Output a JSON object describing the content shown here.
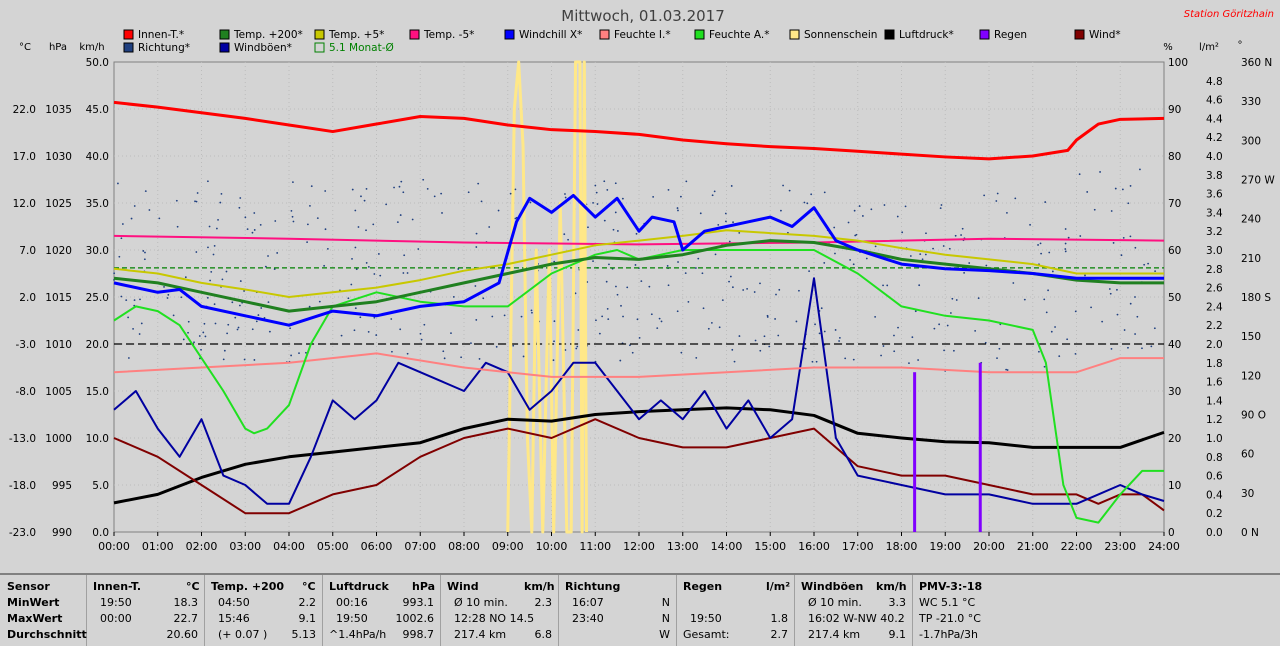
{
  "title": "Mittwoch, 01.03.2017",
  "station": "Station Göritzhain",
  "colors": {
    "bg": "#d4d4d4",
    "plot": "#d4d4d4",
    "innen": "#ff0000",
    "t200": "#208020",
    "t5": "#c8c800",
    "tm5": "#ff1080",
    "windchill": "#0000ff",
    "feuchte_i": "#ff8080",
    "feuchte_a": "#20e020",
    "sonne": "#ffe888",
    "luftdruck": "#000000",
    "regen": "#8000ff",
    "wind": "#800000",
    "richtung": "#204080",
    "boeen": "#0000a0",
    "monat": "#008000"
  },
  "legend": [
    {
      "label": "Innen-T.*",
      "color": "#ff0000"
    },
    {
      "label": "Temp. +200*",
      "color": "#208020"
    },
    {
      "label": "Temp. +5*",
      "color": "#c8c800"
    },
    {
      "label": "Temp. -5*",
      "color": "#ff1080"
    },
    {
      "label": "Windchill X*",
      "color": "#0000ff"
    },
    {
      "label": "Feuchte I.*",
      "color": "#ff8080"
    },
    {
      "label": "Feuchte A.*",
      "color": "#20e020"
    },
    {
      "label": "Sonnenschein",
      "color": "#ffe888"
    },
    {
      "label": "Luftdruck*",
      "color": "#000000"
    },
    {
      "label": "Regen",
      "color": "#8000ff"
    },
    {
      "label": "Wind*",
      "color": "#800000"
    },
    {
      "label": "Richtung*",
      "color": "#204080"
    },
    {
      "label": "Windböen*",
      "color": "#0000a0"
    },
    {
      "label": "5.1 Monat-Ø",
      "color": "#008000",
      "hollow": true
    }
  ],
  "axis_units": {
    "temp": "°C",
    "press": "hPa",
    "wind": "km/h",
    "hum": "%",
    "rain": "l/m²",
    "dir": "°"
  },
  "chart_data": {
    "type": "line",
    "x_unit": "hours",
    "xlim": [
      0,
      24
    ],
    "x_ticks": [
      "00:00",
      "01:00",
      "02:00",
      "03:00",
      "04:00",
      "05:00",
      "06:00",
      "07:00",
      "08:00",
      "09:00",
      "10:00",
      "11:00",
      "12:00",
      "13:00",
      "14:00",
      "15:00",
      "16:00",
      "17:00",
      "18:00",
      "19:00",
      "20:00",
      "21:00",
      "22:00",
      "23:00",
      "24:00"
    ],
    "axes": {
      "temp": {
        "ticks": [
          "22.0",
          "17.0",
          "12.0",
          "7.0",
          "2.0",
          "-3.0",
          "-8.0",
          "-13.0",
          "-18.0",
          "-23.0"
        ],
        "ylim": [
          -23,
          27
        ]
      },
      "press": {
        "ticks": [
          "1035",
          "1030",
          "1025",
          "1020",
          "1015",
          "1010",
          "1005",
          "1000",
          "995",
          "990"
        ],
        "ylim": [
          990,
          1040
        ]
      },
      "wind": {
        "ticks": [
          "50.0",
          "45.0",
          "40.0",
          "35.0",
          "30.0",
          "25.0",
          "20.0",
          "15.0",
          "10.0",
          "5.0",
          "0.0"
        ],
        "ylim": [
          0,
          50
        ]
      },
      "hum": {
        "ticks": [
          "100",
          "90",
          "80",
          "70",
          "60",
          "50",
          "40",
          "30",
          "20",
          "10",
          "0"
        ],
        "ylim": [
          0,
          100
        ]
      },
      "rain": {
        "ticks": [
          "4.8",
          "4.6",
          "4.4",
          "4.2",
          "4.0",
          "3.8",
          "3.6",
          "3.4",
          "3.2",
          "3.0",
          "2.8",
          "2.6",
          "2.4",
          "2.2",
          "2.0",
          "1.8",
          "1.6",
          "1.4",
          "1.2",
          "1.0",
          "0.8",
          "0.6",
          "0.4",
          "0.2",
          "0.0"
        ],
        "ylim": [
          0,
          5
        ]
      },
      "dir": {
        "ticks": [
          "360 N",
          "330",
          "300",
          "270 W",
          "240",
          "210",
          "180 S",
          "150",
          "120",
          "90 O",
          "60",
          "30",
          "0 N"
        ],
        "ylim": [
          0,
          360
        ]
      }
    },
    "series": [
      {
        "name": "Innen-T.*",
        "axis": "temp",
        "color": "#ff0000",
        "width": 3,
        "x": [
          0,
          1,
          2,
          3,
          4,
          5,
          6,
          7,
          8,
          9,
          10,
          11,
          12,
          13,
          14,
          15,
          16,
          17,
          18,
          19,
          20,
          21,
          21.8,
          22,
          22.5,
          23,
          24
        ],
        "y": [
          22.7,
          22.2,
          21.6,
          21.0,
          20.3,
          19.6,
          20.4,
          21.2,
          21.0,
          20.3,
          19.8,
          19.6,
          19.3,
          18.7,
          18.3,
          18.0,
          17.8,
          17.5,
          17.2,
          16.9,
          16.7,
          17.0,
          17.6,
          18.7,
          20.4,
          20.9,
          21.0
        ]
      },
      {
        "name": "Temp. +200*",
        "axis": "temp",
        "color": "#208020",
        "width": 3,
        "x": [
          0,
          1,
          2,
          3,
          4,
          5,
          6,
          7,
          8,
          9,
          10,
          11,
          12,
          13,
          14,
          15,
          16,
          17,
          18,
          19,
          20,
          21,
          22,
          23,
          24
        ],
        "y": [
          4.0,
          3.5,
          2.5,
          1.5,
          0.5,
          1.0,
          1.5,
          2.5,
          3.5,
          4.5,
          5.5,
          6.2,
          6.0,
          6.5,
          7.5,
          8.0,
          7.8,
          7.0,
          6.0,
          5.5,
          5.0,
          4.5,
          3.8,
          3.5,
          3.5
        ]
      },
      {
        "name": "Temp. +5*",
        "axis": "temp",
        "color": "#c8c800",
        "width": 2,
        "x": [
          0,
          1,
          2,
          3,
          4,
          5,
          6,
          7,
          8,
          9,
          10,
          11,
          12,
          13,
          14,
          15,
          16,
          17,
          18,
          19,
          20,
          21,
          22,
          23,
          24
        ],
        "y": [
          5.0,
          4.5,
          3.5,
          2.8,
          2.0,
          2.5,
          3.0,
          3.8,
          4.8,
          5.5,
          6.5,
          7.5,
          8.0,
          8.5,
          9.1,
          8.8,
          8.5,
          8.0,
          7.2,
          6.5,
          6.0,
          5.5,
          4.5,
          4.5,
          4.5
        ]
      },
      {
        "name": "Temp. -5*",
        "axis": "temp",
        "color": "#ff1080",
        "width": 2,
        "x": [
          0,
          4,
          8,
          12,
          16,
          20,
          24
        ],
        "y": [
          8.5,
          8.2,
          7.8,
          7.6,
          7.8,
          8.2,
          8.0
        ]
      },
      {
        "name": "Windchill X*",
        "axis": "temp",
        "color": "#0000ff",
        "width": 3,
        "x": [
          0,
          1,
          1.5,
          2,
          3,
          4,
          5,
          6,
          7,
          8,
          8.8,
          9.2,
          9.5,
          10,
          10.5,
          11,
          11.5,
          12,
          12.3,
          12.8,
          13,
          13.5,
          14,
          14.5,
          15,
          15.5,
          16,
          16.5,
          17,
          18,
          19,
          20,
          21,
          22,
          23,
          24
        ],
        "y": [
          3.5,
          2.5,
          2.8,
          1.0,
          0.0,
          -1.0,
          0.5,
          0.0,
          1.0,
          1.5,
          3.5,
          10.0,
          12.5,
          11.0,
          12.8,
          10.5,
          12.5,
          9.0,
          10.5,
          10.0,
          7.0,
          9.0,
          9.5,
          10.0,
          10.5,
          9.5,
          11.5,
          8.0,
          7.0,
          5.5,
          5.0,
          4.8,
          4.5,
          4.0,
          4.0,
          4.0
        ]
      },
      {
        "name": "Feuchte I.*",
        "axis": "hum",
        "color": "#ff8080",
        "width": 2,
        "x": [
          0,
          2,
          4,
          6,
          8,
          10,
          12,
          14,
          16,
          18,
          20,
          22,
          23,
          24
        ],
        "y": [
          34,
          35,
          36,
          38,
          35,
          33,
          33,
          34,
          35,
          35,
          34,
          34,
          37,
          37
        ]
      },
      {
        "name": "Feuchte A.*",
        "axis": "hum",
        "color": "#20e020",
        "width": 2,
        "x": [
          0,
          0.5,
          1,
          1.5,
          2,
          2.5,
          3,
          3.2,
          3.5,
          4,
          4.5,
          5,
          6,
          7,
          8,
          9,
          10,
          11,
          11.5,
          12,
          13,
          14,
          15,
          16,
          17,
          18,
          19,
          20,
          21,
          21.3,
          21.7,
          22,
          22.5,
          23,
          23.5,
          24
        ],
        "y": [
          45,
          48,
          47,
          44,
          37,
          30,
          22,
          21,
          22,
          27,
          40,
          48,
          51,
          49,
          48,
          48,
          55,
          59,
          60,
          58,
          60,
          60,
          60,
          60,
          55,
          48,
          46,
          45,
          43,
          36,
          10,
          3,
          2,
          8,
          13,
          13
        ]
      },
      {
        "name": "Luftdruck*",
        "axis": "press",
        "color": "#000000",
        "width": 3,
        "x": [
          0,
          1,
          2,
          3,
          4,
          5,
          6,
          7,
          8,
          9,
          10,
          11,
          12,
          13,
          14,
          15,
          16,
          17,
          18,
          19,
          20,
          21,
          22,
          23,
          24
        ],
        "y": [
          993.1,
          994.0,
          995.8,
          997.2,
          998.0,
          998.5,
          999.0,
          999.5,
          1001.0,
          1002.0,
          1001.8,
          1002.5,
          1002.8,
          1003.0,
          1003.2,
          1003.0,
          1002.4,
          1000.5,
          1000.0,
          999.6,
          999.5,
          999.0,
          999.0,
          999.0,
          1000.6
        ]
      },
      {
        "name": "Wind*",
        "axis": "wind",
        "color": "#800000",
        "width": 2,
        "x": [
          0,
          1,
          2,
          3,
          4,
          5,
          6,
          7,
          8,
          9,
          10,
          11,
          12,
          13,
          14,
          15,
          16,
          17,
          18,
          19,
          20,
          21,
          22,
          22.5,
          23,
          23.5,
          24
        ],
        "y": [
          10,
          8,
          5,
          2,
          2,
          4,
          5,
          8,
          10,
          11,
          10,
          12,
          10,
          9,
          9,
          10,
          11,
          7,
          6,
          6,
          5,
          4,
          4,
          3,
          4,
          4,
          2.3
        ]
      },
      {
        "name": "Windböen*",
        "axis": "wind",
        "color": "#0000a0",
        "width": 2,
        "x": [
          0,
          0.5,
          1,
          1.5,
          2,
          2.5,
          3,
          3.5,
          4,
          4.5,
          5,
          5.5,
          6,
          6.5,
          7,
          7.5,
          8,
          8.5,
          9,
          9.5,
          10,
          10.5,
          11,
          11.5,
          12,
          12.5,
          13,
          13.5,
          14,
          14.5,
          15,
          15.5,
          16,
          16.5,
          17,
          18,
          19,
          20,
          21,
          22,
          22.5,
          23,
          23.5,
          24
        ],
        "y": [
          13,
          15,
          11,
          8,
          12,
          6,
          5,
          3,
          3,
          8,
          14,
          12,
          14,
          18,
          17,
          16,
          15,
          18,
          17,
          13,
          15,
          18,
          18,
          15,
          12,
          14,
          12,
          15,
          11,
          14,
          10,
          12,
          27,
          10,
          6,
          5,
          4,
          4,
          3,
          3,
          4,
          5,
          4,
          3.3
        ]
      },
      {
        "name": "Sonnenschein",
        "axis": "hum",
        "color": "#ffe888",
        "width": 3,
        "x": [
          9.0,
          9.15,
          9.25,
          9.35,
          9.45,
          9.55,
          9.65,
          9.8,
          9.95,
          10.05,
          10.2,
          10.35,
          10.45,
          10.55,
          10.65,
          10.7,
          10.75,
          10.8
        ],
        "y": [
          0,
          90,
          100,
          82,
          20,
          0,
          60,
          0,
          60,
          0,
          70,
          0,
          0,
          100,
          100,
          0,
          100,
          0
        ],
        "note_y": "relative"
      }
    ],
    "rain_bars": [
      {
        "x": 18.3,
        "y": 1.7
      },
      {
        "x": 19.8,
        "y": 1.8
      }
    ],
    "hlines": [
      {
        "axis": "temp",
        "y": -3.0,
        "color": "#000000",
        "dash": "8,4"
      },
      {
        "axis": "temp",
        "y": 5.1,
        "color": "#008000",
        "dash": "5,3"
      }
    ],
    "direction_points": "scatter"
  },
  "stats": {
    "sensor": {
      "title": "Sensor",
      "rows": [
        "MinWert",
        "MaxWert",
        "Durchschnitt"
      ]
    },
    "innen": {
      "title": "Innen-T.",
      "unit": "°C",
      "rows": [
        [
          "19:50",
          "18.3"
        ],
        [
          "00:00",
          "22.7"
        ],
        [
          "",
          "20.60"
        ]
      ]
    },
    "temp": {
      "title": "Temp. +200",
      "unit": "°C",
      "rows": [
        [
          "04:50",
          "2.2"
        ],
        [
          "15:46",
          "9.1"
        ],
        [
          "(+ 0.07 )",
          "5.13"
        ]
      ]
    },
    "druck": {
      "title": "Luftdruck",
      "unit": "hPa",
      "rows": [
        [
          "00:16",
          "993.1"
        ],
        [
          "19:50",
          "1002.6"
        ],
        [
          "^1.4hPa/h",
          "998.7"
        ]
      ]
    },
    "wind": {
      "title": "Wind",
      "unit": "km/h",
      "rows": [
        [
          "Ø 10 min.",
          "2.3"
        ],
        [
          "12:28   NO 14.5",
          ""
        ],
        [
          "217.4 km",
          "6.8"
        ]
      ]
    },
    "richtung": {
      "title": "Richtung",
      "unit": "",
      "rows": [
        [
          "16:07",
          "N"
        ],
        [
          "23:40",
          "N"
        ],
        [
          "",
          "W"
        ]
      ]
    },
    "regen": {
      "title": "Regen",
      "unit": "l/m²",
      "rows": [
        [
          "",
          ""
        ],
        [
          "19:50",
          "1.8"
        ],
        [
          "Gesamt:",
          "2.7"
        ]
      ]
    },
    "boeen": {
      "title": "Windböen",
      "unit": "km/h",
      "rows": [
        [
          "Ø 10 min.",
          "3.3"
        ],
        [
          "16:02   W-NW 40.2",
          ""
        ],
        [
          "217.4 km",
          "9.1"
        ]
      ]
    },
    "pmv": {
      "title": "PMV-3:-18",
      "rows": [
        "WC 5.1 °C",
        "TP -21.0 °C",
        "-1.7hPa/3h"
      ]
    }
  }
}
